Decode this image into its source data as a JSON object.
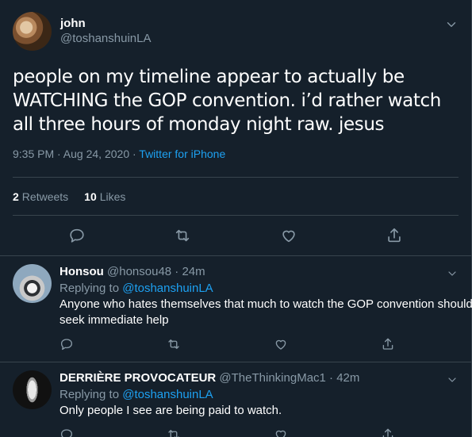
{
  "main_tweet": {
    "name": "john",
    "handle": "@toshanshuinLA",
    "text": "people on my timeline appear to actually be WATCHING the GOP convention. i’d rather watch all three hours of monday night raw. jesus",
    "time": "9:35 PM · Aug 24, 2020 · ",
    "source": "Twitter for iPhone",
    "retweets_count": "2",
    "retweets_label": "Retweets",
    "likes_count": "10",
    "likes_label": "Likes"
  },
  "replies": [
    {
      "name": "Honsou",
      "handle": "@honsou48 · 24m",
      "replying_label": "Replying to ",
      "replying_to": "@toshanshuinLA",
      "text": "Anyone who hates themselves that much to watch the GOP convention should seek immediate help"
    },
    {
      "name": "DERRIÈRE PROVOCATEUR",
      "handle": "@TheThinkingMac1 · 42m",
      "replying_label": "Replying to ",
      "replying_to": "@toshanshuinLA",
      "text": "Only people I see are being paid to watch."
    }
  ],
  "colors": {
    "background": "#15202b",
    "accent": "#1da1f2",
    "secondary_text": "#8899a6",
    "divider": "#38444d"
  },
  "icons": [
    "chevron-down-icon",
    "reply-icon",
    "retweet-icon",
    "like-icon",
    "share-icon"
  ]
}
